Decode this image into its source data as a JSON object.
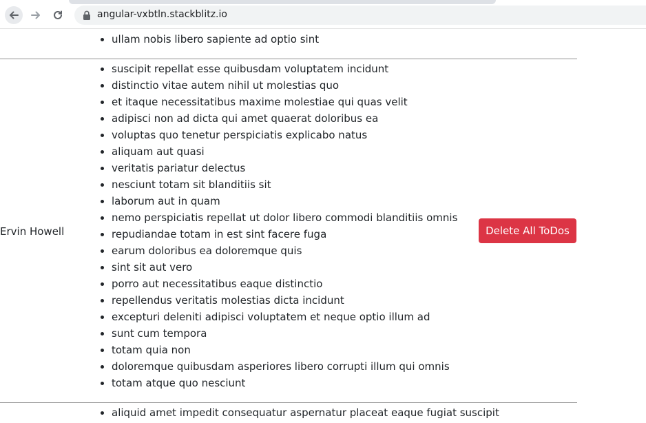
{
  "browser": {
    "url": "angular-vxbtln.stackblitz.io"
  },
  "rows": [
    {
      "todos": [
        "ullam nobis libero sapiente ad optio sint"
      ]
    },
    {
      "name": "Ervin Howell",
      "button_label": "Delete All ToDos",
      "todos": [
        "suscipit repellat esse quibusdam voluptatem incidunt",
        "distinctio vitae autem nihil ut molestias quo",
        "et itaque necessitatibus maxime molestiae qui quas velit",
        "adipisci non ad dicta qui amet quaerat doloribus ea",
        "voluptas quo tenetur perspiciatis explicabo natus",
        "aliquam aut quasi",
        "veritatis pariatur delectus",
        "nesciunt totam sit blanditiis sit",
        "laborum aut in quam",
        "nemo perspiciatis repellat ut dolor libero commodi blanditiis omnis",
        "repudiandae totam in est sint facere fuga",
        "earum doloribus ea doloremque quis",
        "sint sit aut vero",
        "porro aut necessitatibus eaque distinctio",
        "repellendus veritatis molestias dicta incidunt",
        "excepturi deleniti adipisci voluptatem et neque optio illum ad",
        "sunt cum tempora",
        "totam quia non",
        "doloremque quibusdam asperiores libero corrupti illum qui omnis",
        "totam atque quo nesciunt"
      ]
    },
    {
      "todos": [
        "aliquid amet impedit consequatur aspernatur placeat eaque fugiat suscipit"
      ]
    }
  ],
  "colors": {
    "danger": "#dc3545",
    "row_border": "#8f8f8f"
  }
}
